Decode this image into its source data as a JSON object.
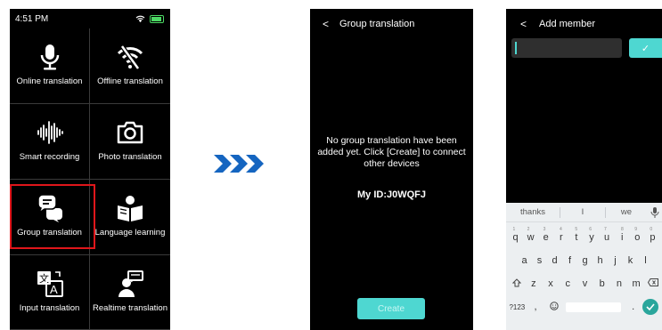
{
  "screen1": {
    "status_time": "4:51 PM",
    "tiles": [
      {
        "label": "Online translation",
        "icon": "microphone-icon"
      },
      {
        "label": "Offline translation",
        "icon": "wifi-off-icon"
      },
      {
        "label": "Smart recording",
        "icon": "soundwave-icon"
      },
      {
        "label": "Photo translation",
        "icon": "camera-icon"
      },
      {
        "label": "Group translation",
        "icon": "chat-bubbles-icon"
      },
      {
        "label": "Language learning",
        "icon": "reading-person-icon"
      },
      {
        "label": "Input translation",
        "icon": "translate-text-icon"
      },
      {
        "label": "Realtime translation",
        "icon": "speaker-person-icon"
      }
    ],
    "highlight_color": "#e0161b"
  },
  "arrow_color": "#1565c0",
  "screen2": {
    "back_glyph": "<",
    "title": "Group translation",
    "empty_message": "No group translation have been added yet. Click [Create] to connect other devices",
    "my_id": "My ID:J0WQFJ",
    "create_label": "Create",
    "accent": "#4ed7d1"
  },
  "screen3": {
    "back_glyph": "<",
    "title": "Add member",
    "confirm_glyph": "✓",
    "keyboard": {
      "suggestions": [
        "thanks",
        "I",
        "we"
      ],
      "row1": [
        "q",
        "w",
        "e",
        "r",
        "t",
        "y",
        "u",
        "i",
        "o",
        "p"
      ],
      "row1_hints": [
        "1",
        "2",
        "3",
        "4",
        "5",
        "6",
        "7",
        "8",
        "9",
        "0"
      ],
      "row2": [
        "a",
        "s",
        "d",
        "f",
        "g",
        "h",
        "j",
        "k",
        "l"
      ],
      "row3": [
        "z",
        "x",
        "c",
        "v",
        "b",
        "n",
        "m"
      ],
      "mode_key": "?123",
      "comma": ",",
      "period": "."
    }
  }
}
